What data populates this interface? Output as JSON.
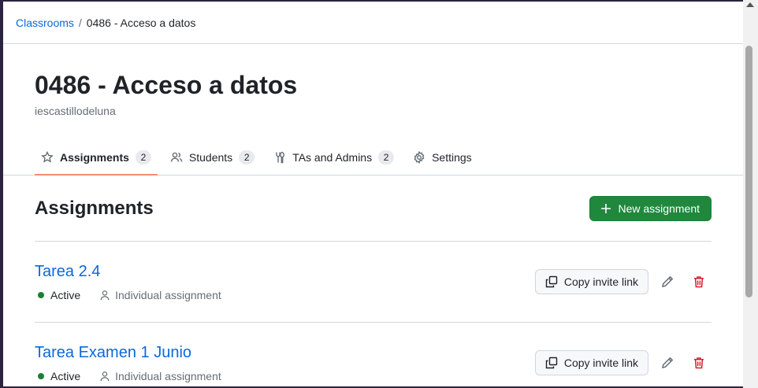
{
  "breadcrumb": {
    "root": "Classrooms",
    "separator": "/",
    "current": "0486 - Acceso a datos"
  },
  "classroom": {
    "title": "0486 - Acceso a datos",
    "organization": "iescastillodeluna"
  },
  "tabs": [
    {
      "label": "Assignments",
      "count": "2",
      "icon": "star-icon",
      "active": true
    },
    {
      "label": "Students",
      "count": "2",
      "icon": "people-icon"
    },
    {
      "label": "TAs and Admins",
      "count": "2",
      "icon": "tools-icon"
    },
    {
      "label": "Settings",
      "icon": "gear-icon"
    }
  ],
  "assignments": {
    "heading": "Assignments",
    "new_button": "New assignment",
    "items": [
      {
        "title": "Tarea 2.4",
        "status": "Active",
        "type": "Individual assignment",
        "copy_label": "Copy invite link"
      },
      {
        "title": "Tarea Examen 1 Junio",
        "status": "Active",
        "type": "Individual assignment",
        "copy_label": "Copy invite link"
      }
    ]
  },
  "colors": {
    "link": "#0969da",
    "primary": "#1f883d",
    "active_tab": "#fd8c73",
    "danger": "#cf222e",
    "status_active": "#1a7f37"
  }
}
